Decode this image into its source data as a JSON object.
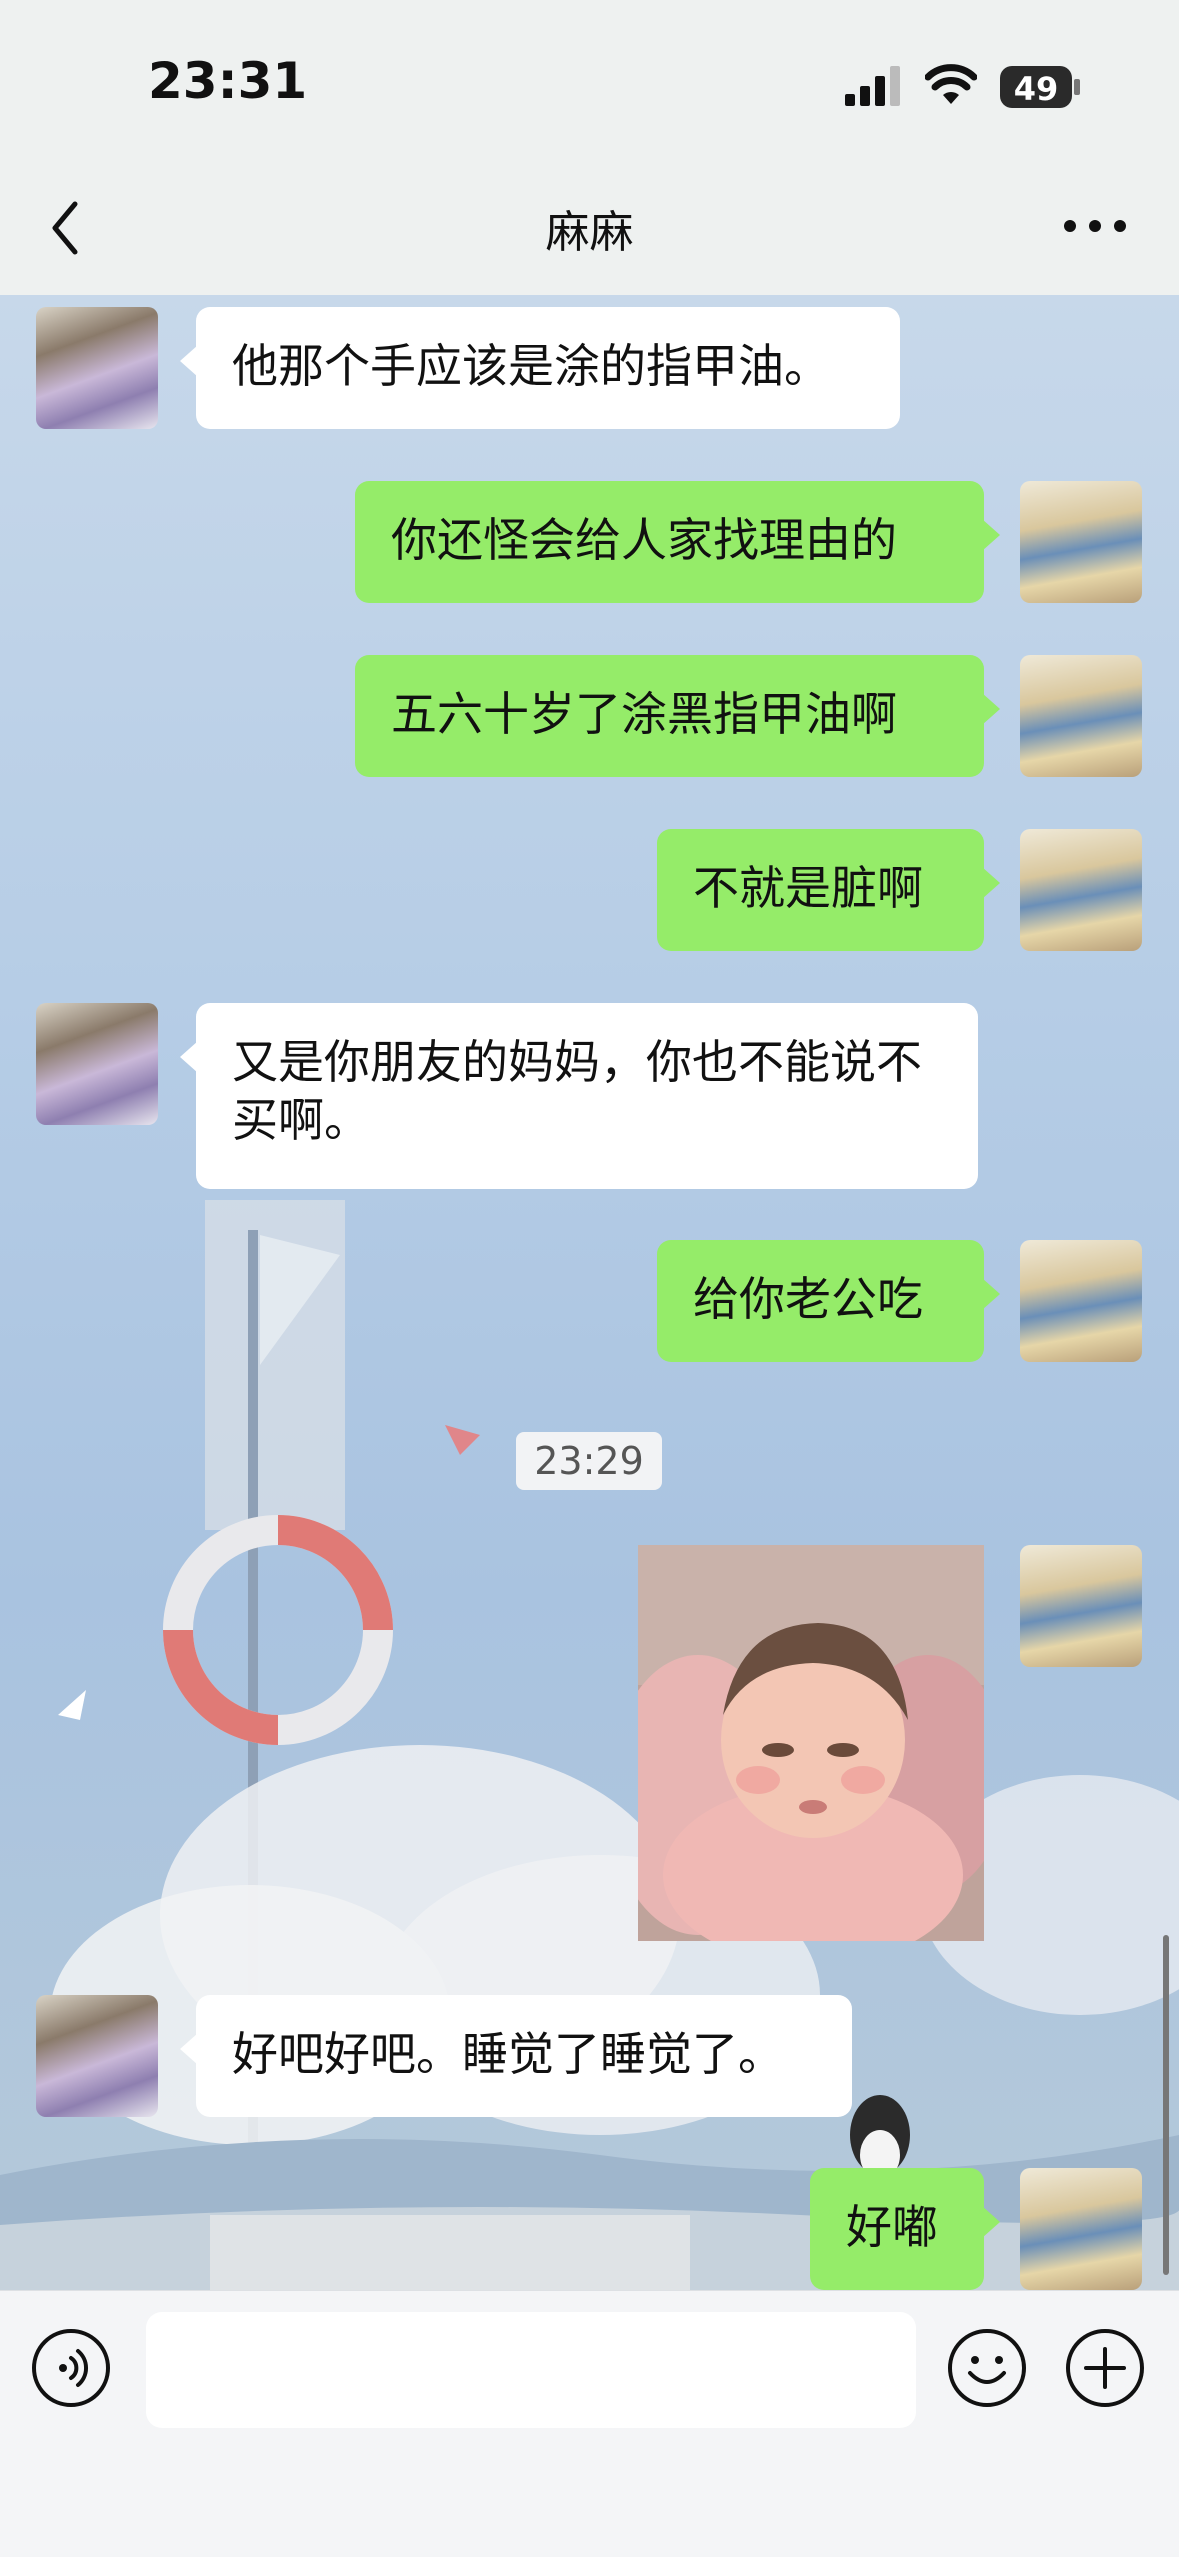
{
  "status_bar": {
    "time": "23:31",
    "battery": "49"
  },
  "header": {
    "title": "麻麻"
  },
  "messages": [
    {
      "side": "left",
      "text": "他那个手应该是涂的指甲油。"
    },
    {
      "side": "right",
      "text": "你还怪会给人家找理由的"
    },
    {
      "side": "right",
      "text": "五六十岁了涂黑指甲油啊"
    },
    {
      "side": "right",
      "text": "不就是脏啊"
    },
    {
      "side": "left",
      "text": "又是你朋友的妈妈，你也不能说不买啊。"
    },
    {
      "side": "right",
      "text": "给你老公吃"
    },
    {
      "side": "right",
      "type": "image"
    },
    {
      "side": "left",
      "text": "好吧好吧。睡觉了睡觉了。"
    },
    {
      "side": "right",
      "text": "好嘟"
    }
  ],
  "timestamp": "23:29",
  "icons": {
    "back": "chevron-left-icon",
    "more": "more-dots-icon",
    "voice": "voice-icon",
    "emoji": "emoji-icon",
    "plus": "plus-icon"
  },
  "colors": {
    "sent_bubble": "#95ec69",
    "received_bubble": "#ffffff",
    "bar": "#eef1f0"
  }
}
